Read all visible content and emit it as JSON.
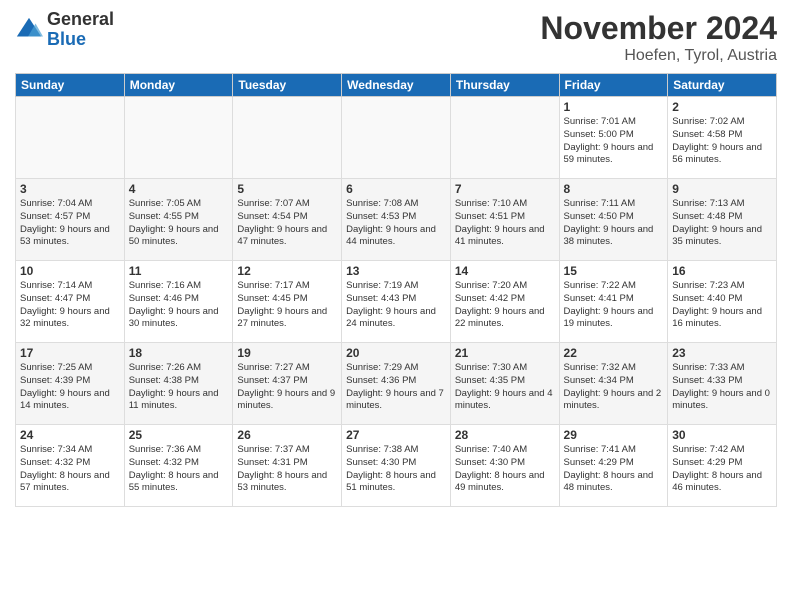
{
  "header": {
    "logo_general": "General",
    "logo_blue": "Blue",
    "month_title": "November 2024",
    "location": "Hoefen, Tyrol, Austria"
  },
  "calendar": {
    "days_of_week": [
      "Sunday",
      "Monday",
      "Tuesday",
      "Wednesday",
      "Thursday",
      "Friday",
      "Saturday"
    ],
    "weeks": [
      [
        {
          "day": "",
          "info": ""
        },
        {
          "day": "",
          "info": ""
        },
        {
          "day": "",
          "info": ""
        },
        {
          "day": "",
          "info": ""
        },
        {
          "day": "",
          "info": ""
        },
        {
          "day": "1",
          "info": "Sunrise: 7:01 AM\nSunset: 5:00 PM\nDaylight: 9 hours and 59 minutes."
        },
        {
          "day": "2",
          "info": "Sunrise: 7:02 AM\nSunset: 4:58 PM\nDaylight: 9 hours and 56 minutes."
        }
      ],
      [
        {
          "day": "3",
          "info": "Sunrise: 7:04 AM\nSunset: 4:57 PM\nDaylight: 9 hours and 53 minutes."
        },
        {
          "day": "4",
          "info": "Sunrise: 7:05 AM\nSunset: 4:55 PM\nDaylight: 9 hours and 50 minutes."
        },
        {
          "day": "5",
          "info": "Sunrise: 7:07 AM\nSunset: 4:54 PM\nDaylight: 9 hours and 47 minutes."
        },
        {
          "day": "6",
          "info": "Sunrise: 7:08 AM\nSunset: 4:53 PM\nDaylight: 9 hours and 44 minutes."
        },
        {
          "day": "7",
          "info": "Sunrise: 7:10 AM\nSunset: 4:51 PM\nDaylight: 9 hours and 41 minutes."
        },
        {
          "day": "8",
          "info": "Sunrise: 7:11 AM\nSunset: 4:50 PM\nDaylight: 9 hours and 38 minutes."
        },
        {
          "day": "9",
          "info": "Sunrise: 7:13 AM\nSunset: 4:48 PM\nDaylight: 9 hours and 35 minutes."
        }
      ],
      [
        {
          "day": "10",
          "info": "Sunrise: 7:14 AM\nSunset: 4:47 PM\nDaylight: 9 hours and 32 minutes."
        },
        {
          "day": "11",
          "info": "Sunrise: 7:16 AM\nSunset: 4:46 PM\nDaylight: 9 hours and 30 minutes."
        },
        {
          "day": "12",
          "info": "Sunrise: 7:17 AM\nSunset: 4:45 PM\nDaylight: 9 hours and 27 minutes."
        },
        {
          "day": "13",
          "info": "Sunrise: 7:19 AM\nSunset: 4:43 PM\nDaylight: 9 hours and 24 minutes."
        },
        {
          "day": "14",
          "info": "Sunrise: 7:20 AM\nSunset: 4:42 PM\nDaylight: 9 hours and 22 minutes."
        },
        {
          "day": "15",
          "info": "Sunrise: 7:22 AM\nSunset: 4:41 PM\nDaylight: 9 hours and 19 minutes."
        },
        {
          "day": "16",
          "info": "Sunrise: 7:23 AM\nSunset: 4:40 PM\nDaylight: 9 hours and 16 minutes."
        }
      ],
      [
        {
          "day": "17",
          "info": "Sunrise: 7:25 AM\nSunset: 4:39 PM\nDaylight: 9 hours and 14 minutes."
        },
        {
          "day": "18",
          "info": "Sunrise: 7:26 AM\nSunset: 4:38 PM\nDaylight: 9 hours and 11 minutes."
        },
        {
          "day": "19",
          "info": "Sunrise: 7:27 AM\nSunset: 4:37 PM\nDaylight: 9 hours and 9 minutes."
        },
        {
          "day": "20",
          "info": "Sunrise: 7:29 AM\nSunset: 4:36 PM\nDaylight: 9 hours and 7 minutes."
        },
        {
          "day": "21",
          "info": "Sunrise: 7:30 AM\nSunset: 4:35 PM\nDaylight: 9 hours and 4 minutes."
        },
        {
          "day": "22",
          "info": "Sunrise: 7:32 AM\nSunset: 4:34 PM\nDaylight: 9 hours and 2 minutes."
        },
        {
          "day": "23",
          "info": "Sunrise: 7:33 AM\nSunset: 4:33 PM\nDaylight: 9 hours and 0 minutes."
        }
      ],
      [
        {
          "day": "24",
          "info": "Sunrise: 7:34 AM\nSunset: 4:32 PM\nDaylight: 8 hours and 57 minutes."
        },
        {
          "day": "25",
          "info": "Sunrise: 7:36 AM\nSunset: 4:32 PM\nDaylight: 8 hours and 55 minutes."
        },
        {
          "day": "26",
          "info": "Sunrise: 7:37 AM\nSunset: 4:31 PM\nDaylight: 8 hours and 53 minutes."
        },
        {
          "day": "27",
          "info": "Sunrise: 7:38 AM\nSunset: 4:30 PM\nDaylight: 8 hours and 51 minutes."
        },
        {
          "day": "28",
          "info": "Sunrise: 7:40 AM\nSunset: 4:30 PM\nDaylight: 8 hours and 49 minutes."
        },
        {
          "day": "29",
          "info": "Sunrise: 7:41 AM\nSunset: 4:29 PM\nDaylight: 8 hours and 48 minutes."
        },
        {
          "day": "30",
          "info": "Sunrise: 7:42 AM\nSunset: 4:29 PM\nDaylight: 8 hours and 46 minutes."
        }
      ]
    ]
  }
}
